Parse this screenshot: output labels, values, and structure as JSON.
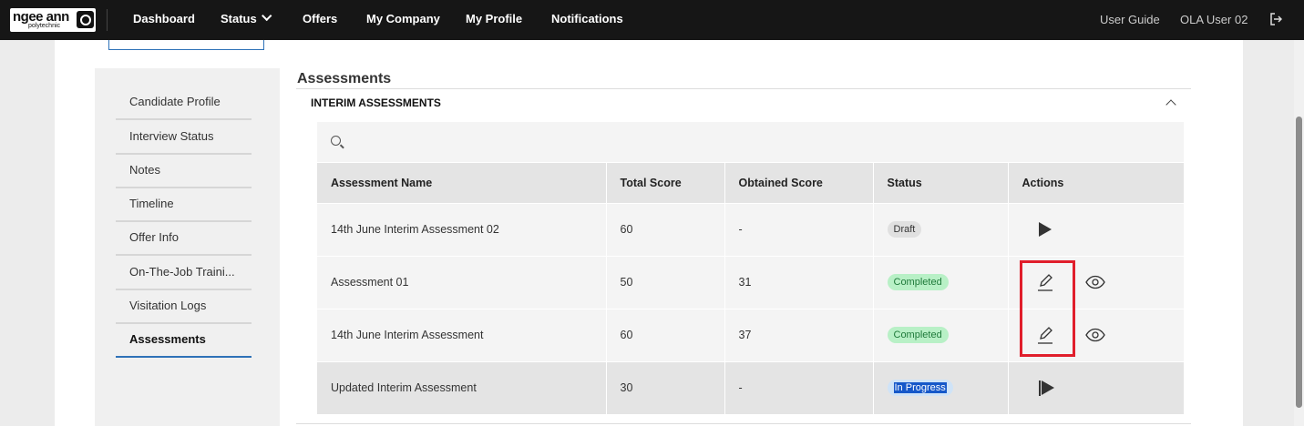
{
  "logo": {
    "main": "ngee ann",
    "sub": "polytechnic"
  },
  "nav": {
    "items": [
      "Dashboard",
      "Status",
      "Offers",
      "My Company",
      "My Profile",
      "Notifications"
    ],
    "user_guide": "User Guide",
    "user": "OLA User 02"
  },
  "sidebar": {
    "items": [
      "Candidate Profile",
      "Interview Status",
      "Notes",
      "Timeline",
      "Offer Info",
      "On-The-Job Traini...",
      "Visitation Logs",
      "Assessments"
    ],
    "active_index": 7
  },
  "main": {
    "title": "Assessments",
    "subheading": "INTERIM ASSESSMENTS",
    "table": {
      "headers": [
        "Assessment Name",
        "Total Score",
        "Obtained Score",
        "Status",
        "Actions"
      ],
      "rows": [
        {
          "name": "14th June Interim Assessment 02",
          "total": "60",
          "obtained": "-",
          "status": "Draft"
        },
        {
          "name": "Assessment 01",
          "total": "50",
          "obtained": "31",
          "status": "Completed"
        },
        {
          "name": "14th June Interim Assessment",
          "total": "60",
          "obtained": "37",
          "status": "Completed"
        },
        {
          "name": "Updated Interim Assessment",
          "total": "30",
          "obtained": "-",
          "status": "In Progress"
        }
      ]
    }
  },
  "colors": {
    "topbar": "#161616",
    "accent": "#2f72b8",
    "completed_bg": "#b8f0c6",
    "highlight": "#e01e2b"
  },
  "icons": [
    "chevron-down-icon",
    "logout-icon",
    "search-icon",
    "chevron-up-icon",
    "play-icon",
    "edit-icon",
    "eye-icon"
  ]
}
